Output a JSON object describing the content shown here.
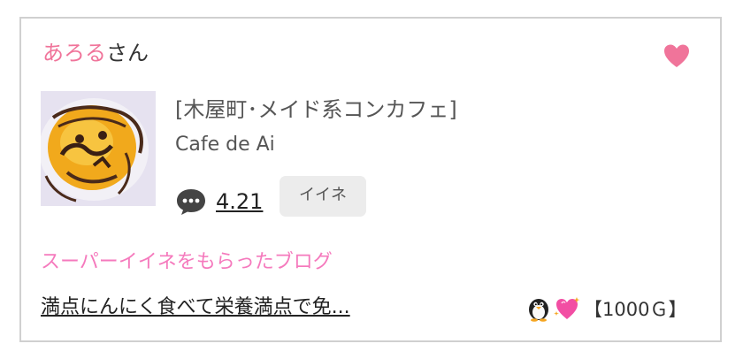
{
  "user": {
    "name": "あろる",
    "suffix": "さん"
  },
  "shop": {
    "genre": "[木屋町･メイド系コンカフェ]",
    "name": "Cafe de Ai"
  },
  "stats": {
    "rating": "4.21",
    "iine_label": "イイネ"
  },
  "section": {
    "title": "スーパーイイネをもらったブログ"
  },
  "blog": {
    "title": "満点にんにく食べて栄養満点で免...",
    "points": "【1000Ｇ】"
  },
  "icons": {
    "favorite": "heart-icon",
    "comment": "comment-icon",
    "badge1": "penguin-icon",
    "badge2": "sparkling-heart-icon"
  },
  "colors": {
    "accent_pink": "#f0749a",
    "section_pink": "#f57abd",
    "border": "#d0d0d0"
  }
}
